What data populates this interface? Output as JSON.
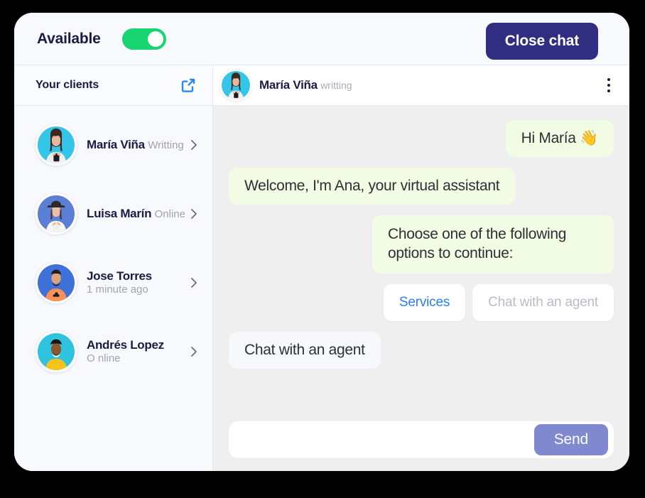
{
  "window": {
    "card_bg": "#f7f9fd",
    "accent_blue": "#2b7ff5",
    "brand_navy": "#312e81",
    "toggle_green": "#17d46e",
    "send_purple": "#8088cf",
    "bubble_green": "#f2fbe4"
  },
  "topbar": {
    "availability_label": "Available",
    "availability_toggle": {
      "state": "on",
      "icon": "toggle-on-icon"
    },
    "close_chat_label": "Close chat"
  },
  "sidebar": {
    "header": {
      "title": "Your clients",
      "share_icon": "share-external-link-icon"
    },
    "clients": [
      {
        "name": "María Viña",
        "status": "Writting",
        "avatar_icon": "avatar-maria-vina",
        "avatar_bg": "#34c6e8",
        "chevron_icon": "chevron-right-icon",
        "selected": true
      },
      {
        "name": "Luisa Marín",
        "status": "Online",
        "avatar_icon": "avatar-luisa-marin",
        "avatar_bg": "#5b7fd4",
        "chevron_icon": "chevron-right-icon",
        "selected": false
      },
      {
        "name": "Jose Torres",
        "status": "1 minute ago",
        "avatar_icon": "avatar-jose-torres",
        "avatar_bg": "#3f72d9",
        "chevron_icon": "chevron-right-icon",
        "selected": false
      },
      {
        "name": "Andrés Lopez",
        "status": "O            nline",
        "avatar_icon": "avatar-andres-lopez",
        "avatar_bg": "#2ec4e0",
        "chevron_icon": "chevron-right-icon",
        "selected": false
      }
    ]
  },
  "conversation": {
    "header": {
      "contact_name": "María Viña",
      "contact_status": "writting",
      "avatar_icon": "avatar-maria-vina",
      "menu_icon": "kebab-menu-icon"
    },
    "messages": [
      {
        "text": "Hi María  👋",
        "side": "right",
        "style": "green"
      },
      {
        "text": "Welcome, I'm Ana, your virtual assistant",
        "side": "left",
        "style": "green"
      },
      {
        "text": "Choose one of the following options to continue:",
        "side": "right",
        "style": "green"
      },
      {
        "text": "Chat with an agent",
        "side": "left",
        "style": "plain"
      }
    ],
    "quick_replies": [
      {
        "label": "Services",
        "emphasis": "primary"
      },
      {
        "label": "Chat with an agent",
        "emphasis": "muted"
      }
    ],
    "composer": {
      "input_value": "",
      "input_placeholder": "",
      "send_label": "Send"
    }
  }
}
